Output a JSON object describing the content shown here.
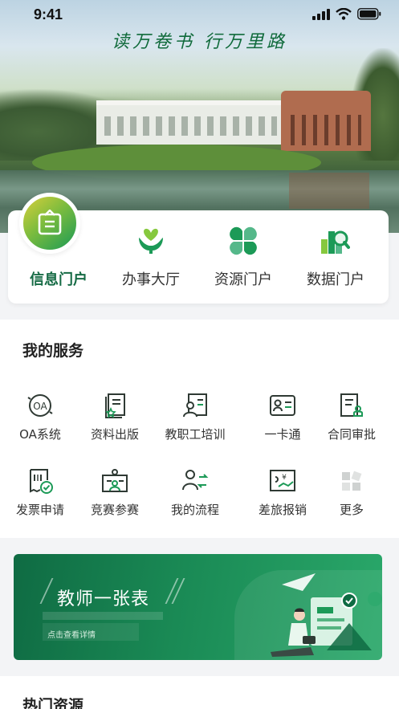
{
  "status_bar": {
    "time": "9:41"
  },
  "hero": {
    "motto": "读万卷书  行万里路"
  },
  "portals": [
    {
      "label": "信息门户",
      "icon": "clipboard-icon",
      "active": true
    },
    {
      "label": "办事大厅",
      "icon": "hands-heart-icon",
      "active": false
    },
    {
      "label": "资源门户",
      "icon": "clover-icon",
      "active": false
    },
    {
      "label": "数据门户",
      "icon": "data-search-icon",
      "active": false
    }
  ],
  "services": {
    "title": "我的服务",
    "items": [
      {
        "label": "OA系统",
        "icon": "oa-icon"
      },
      {
        "label": "资料出版",
        "icon": "publish-icon"
      },
      {
        "label": "教职工培训",
        "icon": "training-icon"
      },
      {
        "label": "一卡通",
        "icon": "id-card-icon"
      },
      {
        "label": "合同审批",
        "icon": "contract-icon"
      },
      {
        "label": "发票申请",
        "icon": "invoice-icon"
      },
      {
        "label": "竞赛参赛",
        "icon": "competition-icon"
      },
      {
        "label": "我的流程",
        "icon": "workflow-icon"
      },
      {
        "label": "差旅报销",
        "icon": "reimbursement-icon"
      },
      {
        "label": "更多",
        "icon": "more-grid-icon"
      }
    ]
  },
  "banner": {
    "title": "教师一张表",
    "subtitle": "点击查看详情"
  },
  "hot": {
    "title": "热门资源"
  },
  "colors": {
    "brand_green": "#166b45",
    "accent_green": "#1a9a55",
    "icon_dark": "#2f3a34"
  }
}
